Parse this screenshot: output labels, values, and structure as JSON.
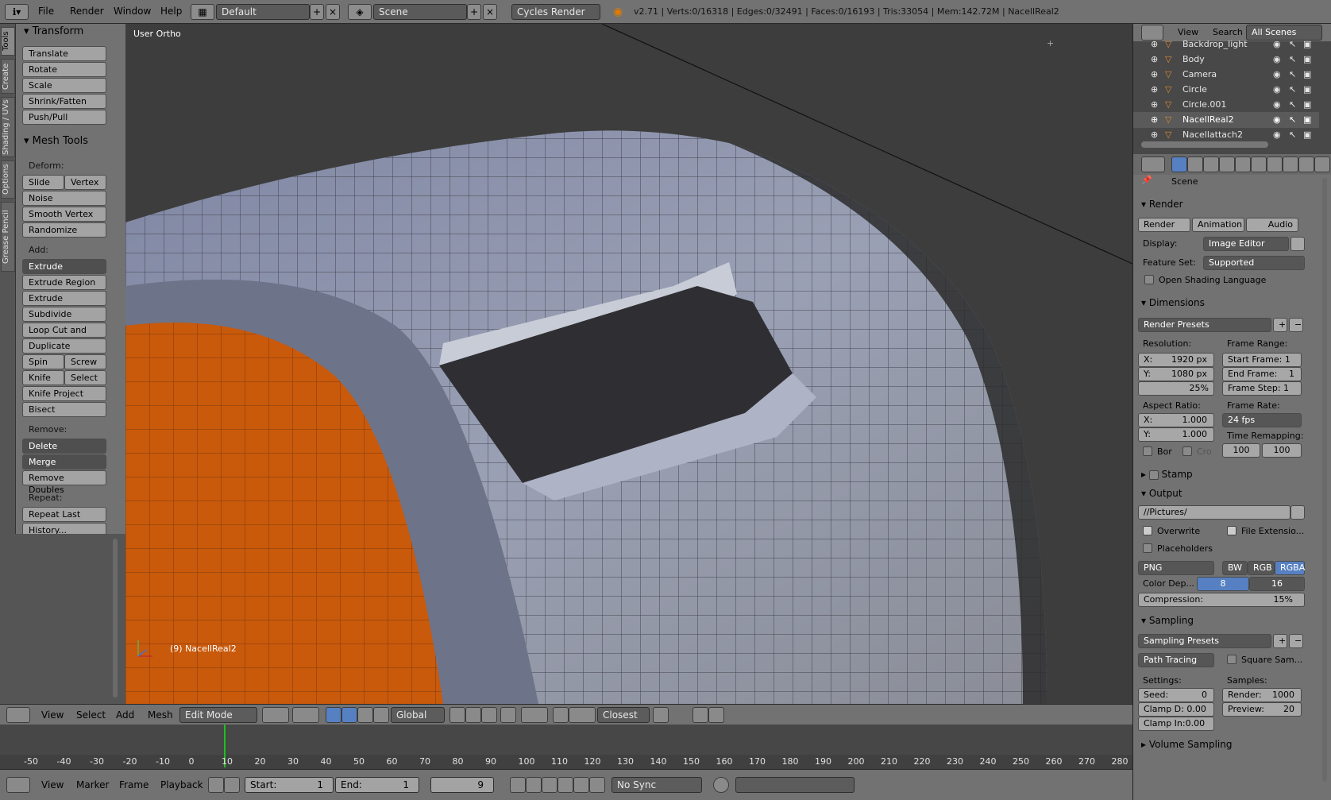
{
  "topbar": {
    "menus": [
      "File",
      "Render",
      "Window",
      "Help"
    ],
    "layout_name": "Default",
    "scene_name": "Scene",
    "engine": "Cycles Render",
    "stats": "v2.71 | Verts:0/16318 | Edges:0/32491 | Faces:0/16193 | Tris:33054 | Mem:142.72M | NacellReal2"
  },
  "tool_tabs": [
    "Tools",
    "Create",
    "Shading / UVs",
    "Options",
    "Grease Pencil"
  ],
  "shelf": {
    "transform_title": "Transform",
    "transform_buttons": [
      "Translate",
      "Rotate",
      "Scale",
      "Shrink/Fatten",
      "Push/Pull"
    ],
    "mesh_tools_title": "Mesh Tools",
    "deform_label": "Deform:",
    "slide_edge": "Slide Ed",
    "vertex": "Vertex",
    "noise": "Noise",
    "smooth_vertex": "Smooth Vertex",
    "randomize": "Randomize",
    "add_label": "Add:",
    "extrude": "Extrude",
    "extrude_region": "Extrude Region",
    "extrude_individual": "Extrude Individual",
    "subdivide": "Subdivide",
    "loop_cut": "Loop Cut and Slide",
    "duplicate": "Duplicate",
    "spin": "Spin",
    "screw": "Screw",
    "knife": "Knife",
    "select": "Select",
    "knife_project": "Knife Project",
    "bisect": "Bisect",
    "remove_label": "Remove:",
    "delete": "Delete",
    "merge": "Merge",
    "remove_doubles": "Remove Doubles",
    "repeat_label": "Repeat:",
    "repeat_last": "Repeat Last",
    "history": "History..."
  },
  "viewport": {
    "view_name": "User Ortho",
    "object_label": "(9) NacellReal2"
  },
  "view3d_header": {
    "menus": [
      "View",
      "Select",
      "Add",
      "Mesh"
    ],
    "mode": "Edit Mode",
    "orientation": "Global",
    "snap": "Closest"
  },
  "timeline": {
    "ticks": [
      "-50",
      "-40",
      "-30",
      "-20",
      "-10",
      "0",
      "10",
      "20",
      "30",
      "40",
      "50",
      "60",
      "70",
      "80",
      "90",
      "100",
      "110",
      "120",
      "130",
      "140",
      "150",
      "160",
      "170",
      "180",
      "190",
      "200",
      "210",
      "220",
      "230",
      "240",
      "250",
      "260",
      "270",
      "280"
    ],
    "current_frame": 9,
    "menus": [
      "View",
      "Marker",
      "Frame",
      "Playback"
    ],
    "start_label": "Start:",
    "start_value": "1",
    "end_label": "End:",
    "end_value": "1",
    "frame_value": "9",
    "sync": "No Sync"
  },
  "outliner": {
    "menus": [
      "View",
      "Search"
    ],
    "scope": "All Scenes",
    "objects": [
      "Backdrop_light",
      "Body",
      "Camera",
      "Circle",
      "Circle.001",
      "NacellReal2",
      "Nacellattach2"
    ],
    "selected_index": 5
  },
  "properties": {
    "scene": "Scene",
    "render_title": "Render",
    "render_btn": "Render",
    "animation_btn": "Animation",
    "audio_btn": "Audio",
    "display_label": "Display:",
    "display_value": "Image Editor",
    "feature_label": "Feature Set:",
    "feature_value": "Supported",
    "osl_label": "Open Shading Language",
    "dimensions_title": "Dimensions",
    "render_presets": "Render Presets",
    "resolution_label": "Resolution:",
    "res_x": "X:",
    "res_x_val": "1920 px",
    "res_y": "Y:",
    "res_y_val": "1080 px",
    "res_pct": "25%",
    "frame_range_label": "Frame Range:",
    "start_frame": "Start Frame: 1",
    "end_frame": "End Frame:",
    "end_frame_val": "1",
    "frame_step": "Frame Step: 1",
    "aspect_label": "Aspect Ratio:",
    "asp_x": "X:",
    "asp_x_val": "1.000",
    "asp_y": "Y:",
    "asp_y_val": "1.000",
    "frame_rate_label": "Frame Rate:",
    "frame_rate": "24 fps",
    "time_remap_label": "Time Remapping:",
    "remap_old": "100",
    "remap_new": "100",
    "border_label": "Bor",
    "crop_label": "Cro",
    "stamp_title": "Stamp",
    "output_title": "Output",
    "output_path": "//Pictures/",
    "overwrite": "Overwrite",
    "file_ext": "File Extensio...",
    "placeholders": "Placeholders",
    "format": "PNG",
    "bw": "BW",
    "rgb": "RGB",
    "rgba": "RGBA",
    "color_depth_label": "Color Dep...",
    "depth_8": "8",
    "depth_16": "16",
    "compression_label": "Compression:",
    "compression_val": "15%",
    "sampling_title": "Sampling",
    "sampling_presets": "Sampling Presets",
    "integrator": "Path Tracing",
    "square_samples": "Square Sam...",
    "settings_label": "Settings:",
    "samples_label": "Samples:",
    "seed_label": "Seed:",
    "seed_val": "0",
    "clamp_d": "Clamp D: 0.00",
    "clamp_i": "Clamp In:0.00",
    "render_samples_label": "Render:",
    "render_samples": "1000",
    "preview_label": "Preview:",
    "preview_samples": "20",
    "volume_title": "Volume Sampling"
  },
  "colors": {
    "ui_grey": "#727272",
    "viewport_bg": "#3d3d3d",
    "orange_sphere": "#c9590b",
    "selection_blue": "#5680c2",
    "playhead_green": "#1fbf1f"
  }
}
